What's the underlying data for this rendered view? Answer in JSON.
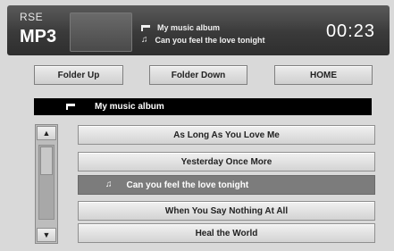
{
  "header": {
    "source_small": "RSE",
    "source_big": "MP3",
    "album_line": "My music album",
    "track_line": "Can you feel the love tonight",
    "time": "00:23",
    "folder_icon": "folder-icon",
    "note_icon": "music-note-icon"
  },
  "nav": {
    "folder_up": "Folder Up",
    "folder_down": "Folder Down",
    "home": "HOME"
  },
  "folder_bar": {
    "label": "My music album"
  },
  "scroll": {
    "up": "▲",
    "down": "▼"
  },
  "tracks": [
    {
      "title": "As Long As You Love Me",
      "selected": false
    },
    {
      "title": "Yesterday Once More",
      "selected": false
    },
    {
      "title": "Can you feel the love tonight",
      "selected": true
    },
    {
      "title": "When You Say Nothing At All",
      "selected": false
    },
    {
      "title": "Heal the World",
      "selected": false
    }
  ],
  "colors": {
    "header_bg": "#3a3a3a",
    "selected_bg": "#7c7c7c",
    "folder_bar_bg": "#000000"
  }
}
